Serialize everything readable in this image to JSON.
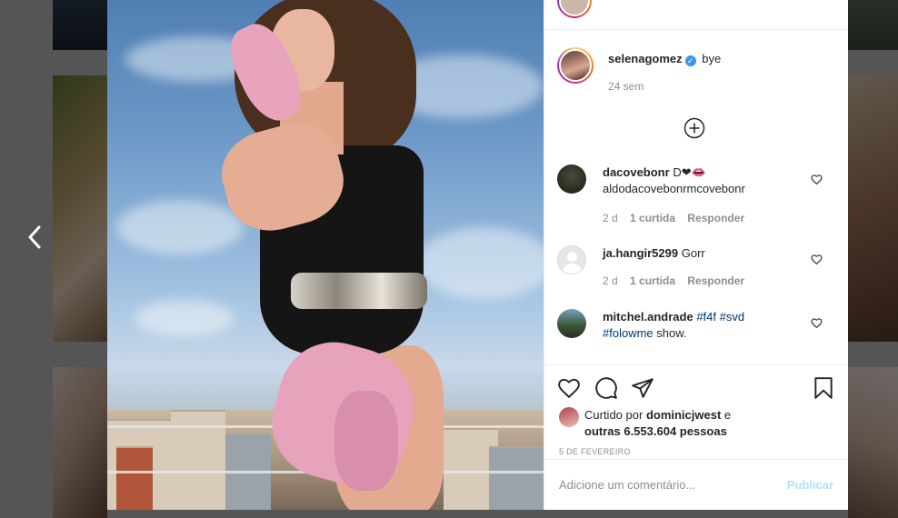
{
  "post": {
    "author": "selenagomez",
    "verified_icon": "verified-badge-icon",
    "caption": "bye",
    "time_ago": "24 sem"
  },
  "top_strip": {
    "text_prefix": "",
    "text_blue": ""
  },
  "comments": [
    {
      "username": "dacovebonr",
      "text": "D❤👄",
      "text_line2": "aldodacovebonrmcovebonr",
      "age": "2 d",
      "likes": "1 curtida",
      "reply": "Responder"
    },
    {
      "username": "ja.hangir5299",
      "text": "Gorr",
      "age": "2 d",
      "likes": "1 curtida",
      "reply": "Responder"
    },
    {
      "username": "mitchel.andrade",
      "hashtag1": "#f4f",
      "hashtag2": "#svd",
      "hashtag3": "#folowme",
      "text_tail": "show."
    }
  ],
  "likes": {
    "prefix": "Curtido por",
    "liker": "dominicjwest",
    "conj": "e",
    "others": "outras 6.553.604 pessoas"
  },
  "date": "5 DE FEVEREIRO",
  "comment_box": {
    "placeholder": "Adicione um comentário...",
    "publish_label": "Publicar"
  },
  "icons": {
    "prev": "chevron-left-icon",
    "load_more": "plus-circle-icon",
    "like": "heart-icon",
    "comment": "comment-icon",
    "share": "paper-plane-icon",
    "save": "bookmark-icon"
  },
  "colors": {
    "link_blue": "#0095f6",
    "publish_disabled": "#b2dffc",
    "verified": "#3897f0",
    "muted": "#8e8e8e"
  }
}
